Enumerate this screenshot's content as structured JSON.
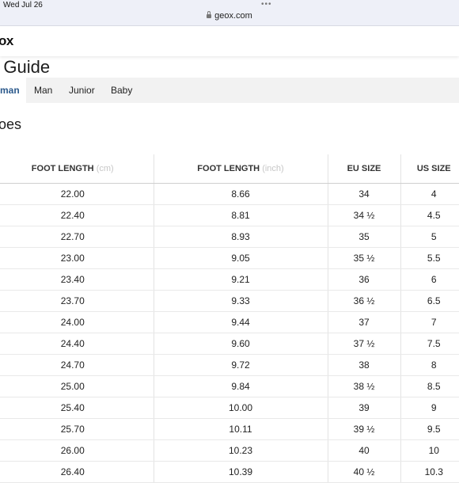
{
  "statusbar": {
    "time": "Wed Jul 26",
    "dots": "•••",
    "url": "geox.com"
  },
  "site": {
    "logo": "ox"
  },
  "page": {
    "title": "e Guide"
  },
  "tabs": [
    {
      "label": "man",
      "active": true
    },
    {
      "label": "Man",
      "active": false
    },
    {
      "label": "Junior",
      "active": false
    },
    {
      "label": "Baby",
      "active": false
    }
  ],
  "section": {
    "title": "hoes"
  },
  "table": {
    "headers": [
      {
        "label": "FOOT LENGTH",
        "unit": "(cm)"
      },
      {
        "label": "FOOT LENGTH",
        "unit": "(inch)"
      },
      {
        "label": "EU SIZE",
        "unit": ""
      },
      {
        "label": "US SIZE",
        "unit": ""
      }
    ],
    "rows": [
      [
        "22.00",
        "8.66",
        "34",
        "4"
      ],
      [
        "22.40",
        "8.81",
        "34 ½",
        "4.5"
      ],
      [
        "22.70",
        "8.93",
        "35",
        "5"
      ],
      [
        "23.00",
        "9.05",
        "35 ½",
        "5.5"
      ],
      [
        "23.40",
        "9.21",
        "36",
        "6"
      ],
      [
        "23.70",
        "9.33",
        "36 ½",
        "6.5"
      ],
      [
        "24.00",
        "9.44",
        "37",
        "7"
      ],
      [
        "24.40",
        "9.60",
        "37 ½",
        "7.5"
      ],
      [
        "24.70",
        "9.72",
        "38",
        "8"
      ],
      [
        "25.00",
        "9.84",
        "38 ½",
        "8.5"
      ],
      [
        "25.40",
        "10.00",
        "39",
        "9"
      ],
      [
        "25.70",
        "10.11",
        "39 ½",
        "9.5"
      ],
      [
        "26.00",
        "10.23",
        "40",
        "10"
      ],
      [
        "26.40",
        "10.39",
        "40 ½",
        "10.3"
      ]
    ]
  },
  "colors": {
    "accent": "#2c5a8c",
    "tab_bg": "#f2f2f2",
    "bar_bg": "#eef0f8"
  }
}
